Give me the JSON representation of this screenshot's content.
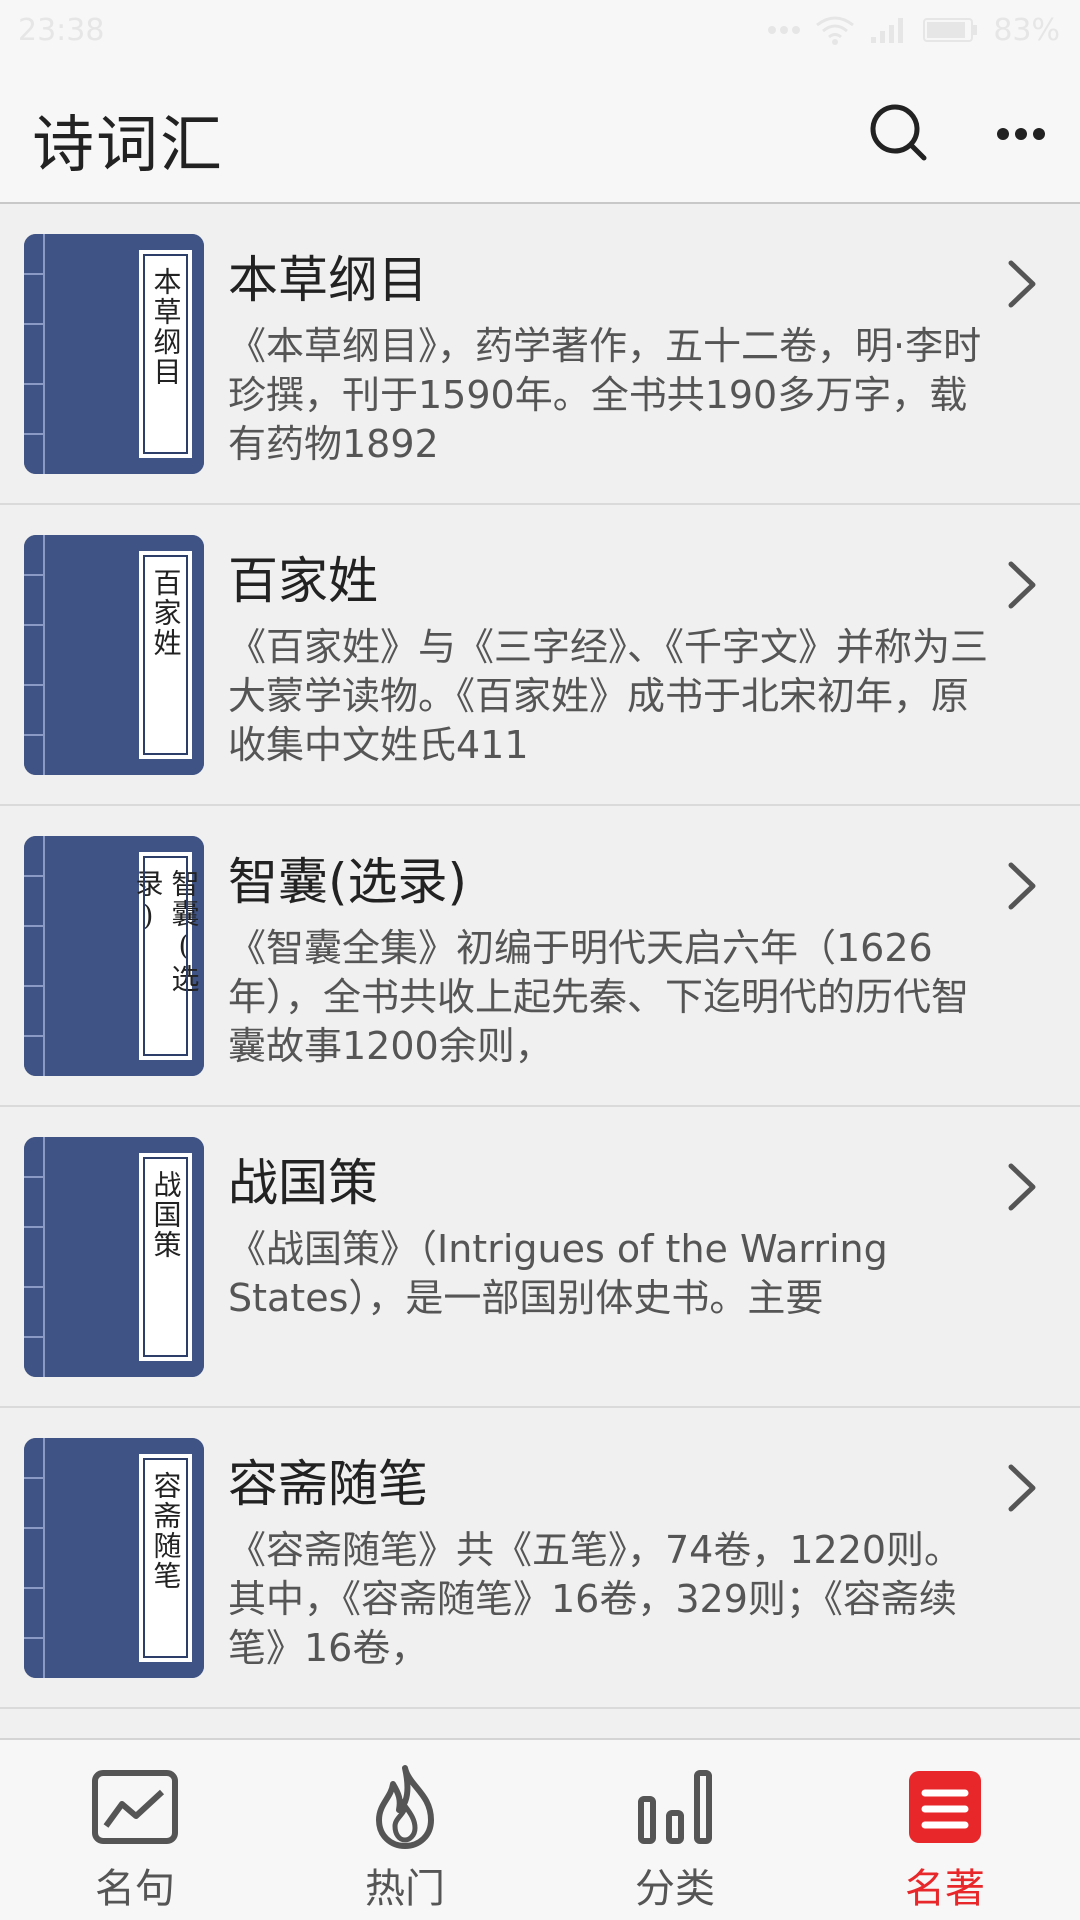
{
  "status_bar": {
    "time": "23:38",
    "battery": "83%"
  },
  "app_bar": {
    "title": "诗词汇",
    "search_icon": "search-icon",
    "more_icon": "more-icon"
  },
  "books": [
    {
      "cover_text": "本草纲目",
      "title": "本草纲目",
      "description": "《本草纲目》，药学著作，五十二卷，明·李时珍撰，刊于1590年。全书共190多万字，载有药物1892"
    },
    {
      "cover_text": "百家姓",
      "title": "百家姓",
      "description": "《百家姓》与《三字经》、《千字文》并称为三大蒙学读物。《百家姓》成书于北宋初年，原收集中文姓氏411"
    },
    {
      "cover_text": "智囊(选录)",
      "title": "智囊(选录)",
      "description": "《智囊全集》初编于明代天启六年（1626年），全书共收上起先秦、下迄明代的历代智囊故事1200余则，"
    },
    {
      "cover_text": "战国策",
      "title": "战国策",
      "description": "《战国策》（Intrigues of the Warring States），是一部国别体史书。主要"
    },
    {
      "cover_text": "容斋随笔",
      "title": "容斋随笔",
      "description": "《容斋随笔》共《五笔》，74卷，1220则。其中，《容斋随笔》16卷，329则；《容斋续笔》16卷，"
    }
  ],
  "tabs": [
    {
      "label": "名句",
      "icon": "chart-card-icon",
      "active": false
    },
    {
      "label": "热门",
      "icon": "flame-icon",
      "active": false
    },
    {
      "label": "分类",
      "icon": "bar-chart-icon",
      "active": false
    },
    {
      "label": "名著",
      "icon": "book-list-icon",
      "active": true
    }
  ],
  "colors": {
    "accent": "#e8272a",
    "cover_blue": "#3f5384",
    "background": "#f0f0f0"
  }
}
